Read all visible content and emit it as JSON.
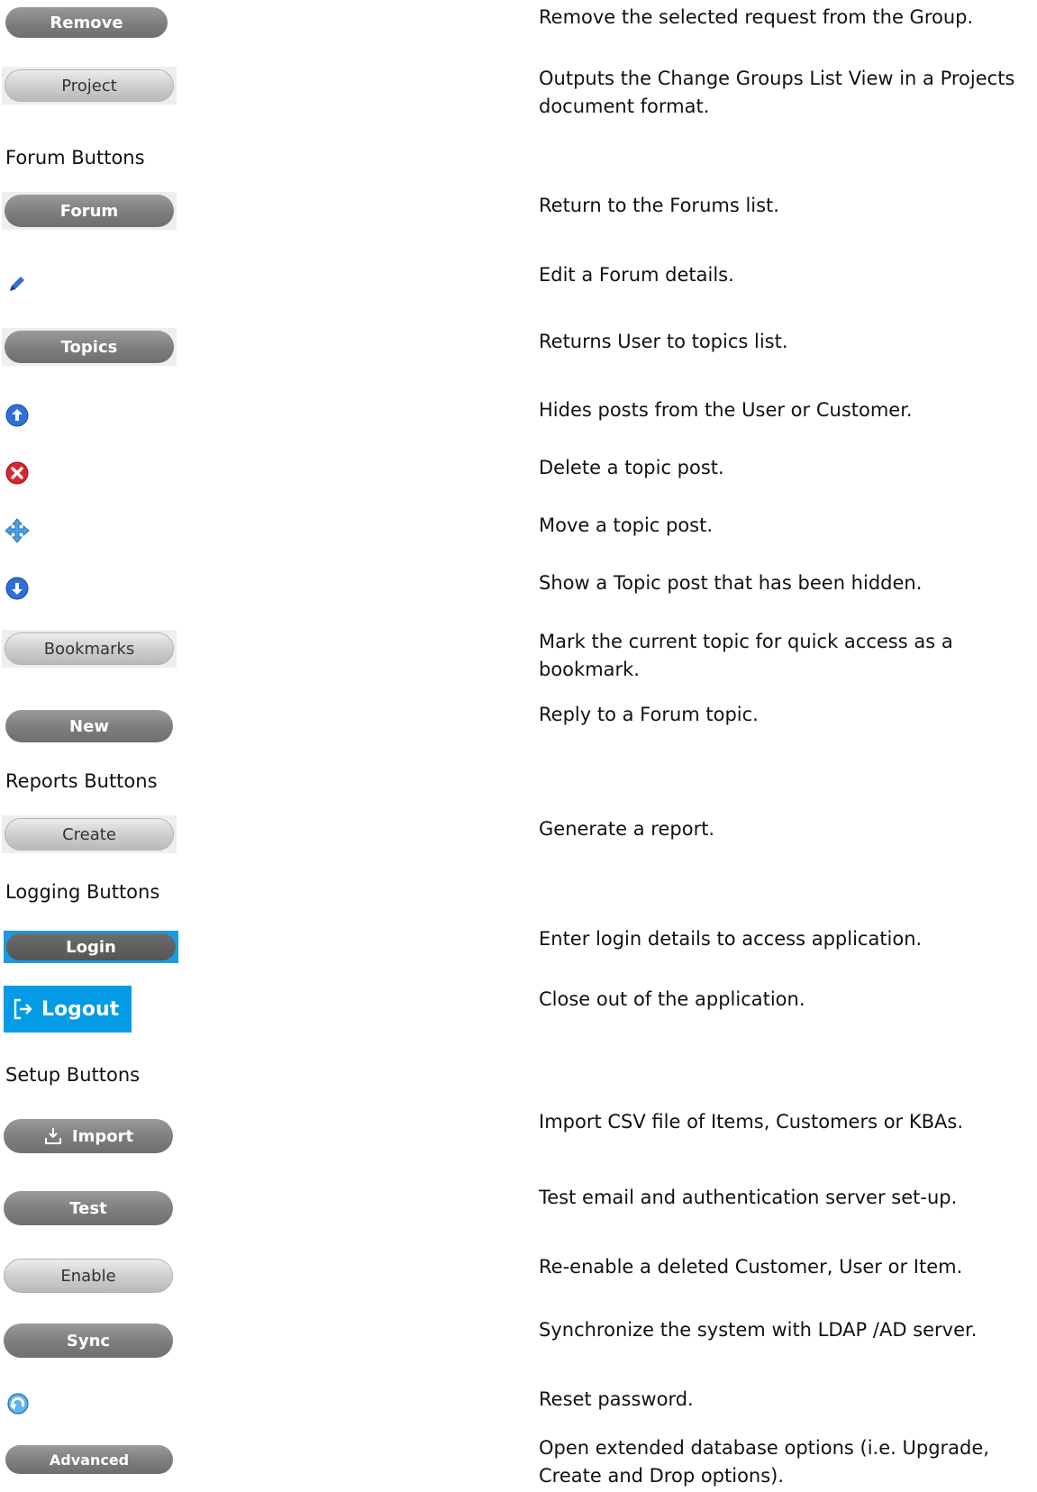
{
  "rows": [
    {
      "button": "Remove",
      "desc": "Remove the selected request from the Group."
    },
    {
      "button": "Project",
      "desc": "Outputs the Change Groups List View in a Projects document format."
    },
    {
      "button": "Forum",
      "desc": "Return to the Forums list."
    },
    {
      "icon": "pencil-icon",
      "desc": "Edit a Forum details."
    },
    {
      "button": "Topics",
      "desc": "Returns User to topics list."
    },
    {
      "icon": "up-arrow-circle-icon",
      "desc": "Hides posts from the User or Customer."
    },
    {
      "icon": "red-x-circle-icon",
      "desc": "Delete a topic post."
    },
    {
      "icon": "move-arrows-icon",
      "desc": "Move a topic post."
    },
    {
      "icon": "down-arrow-circle-icon",
      "desc": "Show a Topic post that has been hidden."
    },
    {
      "button": "Bookmarks",
      "desc": "Mark the current topic for quick access as a bookmark."
    },
    {
      "button": "New",
      "desc": "Reply to a Forum topic."
    },
    {
      "button": "Create",
      "desc": "Generate a report."
    },
    {
      "button": "Login",
      "desc": "Enter login details to access application."
    },
    {
      "button": "Logout",
      "desc": "Close out of the application."
    },
    {
      "button": "Import",
      "desc": "Import CSV file of Items, Customers or KBAs."
    },
    {
      "button": "Test",
      "desc": "Test email and authentication server set-up."
    },
    {
      "button": "Enable",
      "desc": "Re-enable a deleted Customer, User or Item."
    },
    {
      "button": "Sync",
      "desc": "Synchronize the system with LDAP /AD server."
    },
    {
      "icon": "reset-password-icon",
      "desc": "Reset password."
    },
    {
      "button": "Advanced",
      "desc": "Open extended database options (i.e. Upgrade, Create and Drop options)."
    }
  ],
  "headings": {
    "forum": "Forum Buttons",
    "reports": "Reports Buttons",
    "logging": "Logging Buttons",
    "setup": "Setup Buttons"
  },
  "colors": {
    "logout_bg": "#039be5",
    "login_border": "#1a9be0",
    "icon_blue": "#2f6fd6",
    "icon_red": "#d9252b"
  }
}
